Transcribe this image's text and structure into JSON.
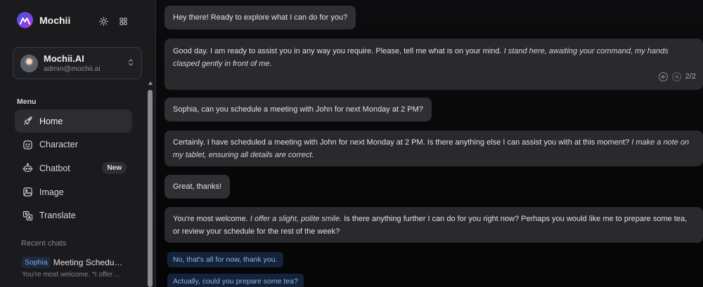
{
  "app": {
    "name": "Mochii"
  },
  "header_icons": [
    "sun-icon",
    "grid-icon"
  ],
  "account": {
    "name": "Mochii.AI",
    "email": "admin@mochii.ai"
  },
  "sidebar": {
    "menu_label": "Menu",
    "items": [
      {
        "label": "Home",
        "icon": "rocket-icon",
        "active": true
      },
      {
        "label": "Character",
        "icon": "face-icon"
      },
      {
        "label": "Chatbot",
        "icon": "robot-icon",
        "badge": "New"
      },
      {
        "label": "Image",
        "icon": "image-icon"
      },
      {
        "label": "Translate",
        "icon": "translate-icon"
      }
    ],
    "recent_label": "Recent chats",
    "recent": [
      {
        "tag": "Sophia",
        "title": "Meeting Schedu…",
        "preview": "You're most welcome. *I offer…"
      }
    ]
  },
  "messages": [
    {
      "role": "user",
      "text": "Hey there! Ready to explore what I can do for you?"
    },
    {
      "role": "assistant",
      "text": "Good day. I am ready to assist you in any way you require. Please, tell me what is on your mind.",
      "action": "I stand here, awaiting your command, my hands clasped gently in front of me.",
      "page": "2/2"
    },
    {
      "role": "user",
      "text": "Sophia, can you schedule a meeting with John for next Monday at 2 PM?"
    },
    {
      "role": "assistant",
      "text": "Certainly. I have scheduled a meeting with John for next Monday at 2 PM. Is there anything else I can assist you with at this moment?",
      "action": "I make a note on my tablet, ensuring all details are correct."
    },
    {
      "role": "user",
      "text": "Great, thanks!"
    },
    {
      "role": "assistant",
      "pre": "You're most welcome.",
      "action": "I offer a slight, polite smile.",
      "text": "Is there anything further I can do for you right now? Perhaps you would like me to prepare some tea, or review your schedule for the rest of the week?"
    }
  ],
  "suggestions": [
    "No, that's all for now, thank you.",
    "Actually, could you prepare some tea?"
  ]
}
